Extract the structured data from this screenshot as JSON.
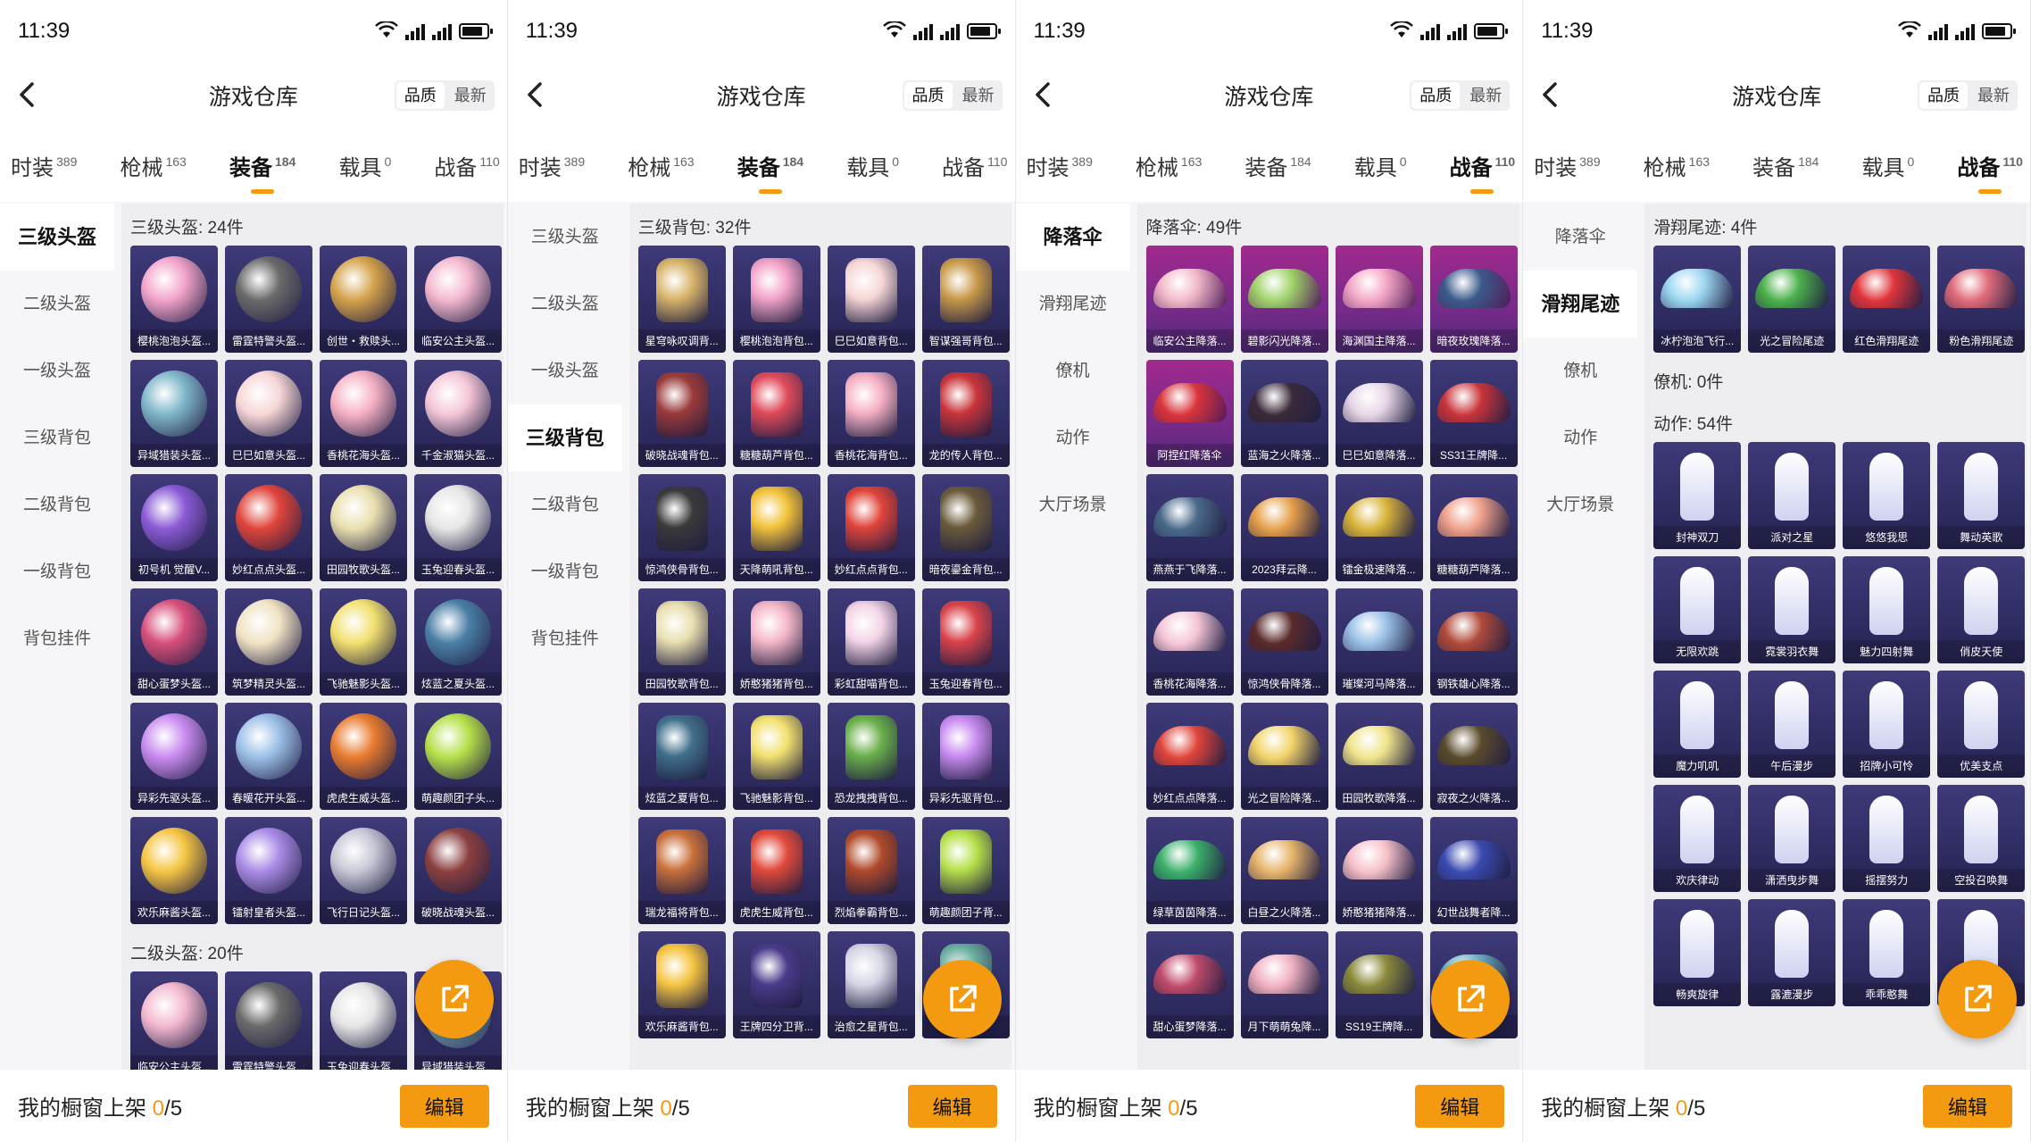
{
  "panels": [
    {
      "id": "p1",
      "time": "11:39",
      "title": "游戏仓库",
      "sort": [
        "品质",
        "最新"
      ],
      "tabs": [
        {
          "label": "时装",
          "count": "389",
          "active": false
        },
        {
          "label": "枪械",
          "count": "163",
          "active": false
        },
        {
          "label": "装备",
          "count": "184",
          "active": true
        },
        {
          "label": "载具",
          "count": "0",
          "active": false
        },
        {
          "label": "战备",
          "count": "110",
          "active": false
        }
      ],
      "side": [
        {
          "label": "三级头盔",
          "active": true
        },
        {
          "label": "二级头盔",
          "active": false
        },
        {
          "label": "一级头盔",
          "active": false
        },
        {
          "label": "三级背包",
          "active": false
        },
        {
          "label": "二级背包",
          "active": false
        },
        {
          "label": "一级背包",
          "active": false
        },
        {
          "label": "背包挂件",
          "active": false
        }
      ],
      "sections": [
        {
          "title": "三级头盔: 24件",
          "kind": "helmet",
          "items": [
            {
              "name": "樱桃泡泡头盔...",
              "color": "#f2a3c9"
            },
            {
              "name": "雷霆特警头盔...",
              "color": "#6a6a6a"
            },
            {
              "name": "创世・救赎头...",
              "color": "#d4a24a"
            },
            {
              "name": "临安公主头盔...",
              "color": "#f3b8cf"
            },
            {
              "name": "异域猎装头盔...",
              "color": "#7fb6c9"
            },
            {
              "name": "巳巳如意头盔...",
              "color": "#f7d6d6"
            },
            {
              "name": "香桃花海头盔...",
              "color": "#f6b1c4"
            },
            {
              "name": "千金淑猫头盔...",
              "color": "#f4c6d7"
            },
            {
              "name": "初号机 觉醒V...",
              "color": "#8b5bd6"
            },
            {
              "name": "妙红点点头盔...",
              "color": "#e0443a"
            },
            {
              "name": "田园牧歌头盔...",
              "color": "#e9dfae"
            },
            {
              "name": "玉兔迎春头盔...",
              "color": "#e6e6e6"
            },
            {
              "name": "甜心蛋梦头盔...",
              "color": "#d74f7b"
            },
            {
              "name": "筑梦精灵头盔...",
              "color": "#f1e3c3"
            },
            {
              "name": "飞驰魅影头盔...",
              "color": "#f2e06f"
            },
            {
              "name": "炫蓝之夏头盔...",
              "color": "#4a7fa6"
            },
            {
              "name": "异彩先驱头盔...",
              "color": "#c98bf0"
            },
            {
              "name": "春暖花开头盔...",
              "color": "#9bbfe6"
            },
            {
              "name": "虎虎生威头盔...",
              "color": "#e87a2e"
            },
            {
              "name": "萌趣颜团子头...",
              "color": "#b6e04a"
            },
            {
              "name": "欢乐麻酱头盔...",
              "color": "#f5c542"
            },
            {
              "name": "镭射皇者头盔...",
              "color": "#a98be6"
            },
            {
              "name": "飞行日记头盔...",
              "color": "#c7c7d6"
            },
            {
              "name": "破晓战魂头盔...",
              "color": "#8a3f3f"
            }
          ]
        },
        {
          "title": "二级头盔: 20件",
          "kind": "helmet",
          "items": [
            {
              "name": "临安公主头盔...",
              "color": "#f3b8cf"
            },
            {
              "name": "雷霆特警头盔...",
              "color": "#6a6a6a"
            },
            {
              "name": "玉兔迎春头盔...",
              "color": "#e6e6e6"
            },
            {
              "name": "异域猎装头盔...",
              "color": "#7fb6c9"
            }
          ]
        }
      ],
      "bottom": {
        "label": "我的橱窗上架",
        "count": "0",
        "total": "/5",
        "edit": "编辑"
      }
    },
    {
      "id": "p2",
      "time": "11:39",
      "title": "游戏仓库",
      "sort": [
        "品质",
        "最新"
      ],
      "tabs": [
        {
          "label": "时装",
          "count": "389",
          "active": false
        },
        {
          "label": "枪械",
          "count": "163",
          "active": false
        },
        {
          "label": "装备",
          "count": "184",
          "active": true
        },
        {
          "label": "载具",
          "count": "0",
          "active": false
        },
        {
          "label": "战备",
          "count": "110",
          "active": false
        }
      ],
      "side": [
        {
          "label": "三级头盔",
          "active": false
        },
        {
          "label": "二级头盔",
          "active": false
        },
        {
          "label": "一级头盔",
          "active": false
        },
        {
          "label": "三级背包",
          "active": true
        },
        {
          "label": "二级背包",
          "active": false
        },
        {
          "label": "一级背包",
          "active": false
        },
        {
          "label": "背包挂件",
          "active": false
        }
      ],
      "sections": [
        {
          "title": "三级背包: 32件",
          "kind": "pack",
          "items": [
            {
              "name": "星穹咏叹调背...",
              "color": "#d8b46a"
            },
            {
              "name": "樱桃泡泡背包...",
              "color": "#f2a3c9"
            },
            {
              "name": "巳巳如意背包...",
              "color": "#f7d6d6"
            },
            {
              "name": "智谋强哥背包...",
              "color": "#c99a4a"
            },
            {
              "name": "破晓战魂背包...",
              "color": "#9b3a3a"
            },
            {
              "name": "糖糖葫芦背包...",
              "color": "#e04a5a"
            },
            {
              "name": "香桃花海背包...",
              "color": "#f6b1c4"
            },
            {
              "name": "龙的传人背包...",
              "color": "#c9343a"
            },
            {
              "name": "惊鸿侠骨背包...",
              "color": "#3a3a3a"
            },
            {
              "name": "天降萌吼背包...",
              "color": "#f2c23a"
            },
            {
              "name": "妙红点点背包...",
              "color": "#e0443a"
            },
            {
              "name": "暗夜鎏金背包...",
              "color": "#6a5a3a"
            },
            {
              "name": "田园牧歌背包...",
              "color": "#e9dfae"
            },
            {
              "name": "娇憨猪猪背包...",
              "color": "#f6b8c8"
            },
            {
              "name": "彩虹甜喵背包...",
              "color": "#f3d4e6"
            },
            {
              "name": "玉兔迎春背包...",
              "color": "#d9434a"
            },
            {
              "name": "炫蓝之夏背包...",
              "color": "#3f6f8a"
            },
            {
              "name": "飞驰魅影背包...",
              "color": "#f2e06f"
            },
            {
              "name": "恐龙拽拽背包...",
              "color": "#6ab04a"
            },
            {
              "name": "异彩先驱背包...",
              "color": "#c98bf0"
            },
            {
              "name": "瑞龙福将背包...",
              "color": "#c9703a"
            },
            {
              "name": "虎虎生威背包...",
              "color": "#e04a3a"
            },
            {
              "name": "烈焰拳霸背包...",
              "color": "#b04a2a"
            },
            {
              "name": "萌趣颜团子背...",
              "color": "#b6e04a"
            },
            {
              "name": "欢乐麻酱背包...",
              "color": "#f5c542"
            },
            {
              "name": "王牌四分卫背...",
              "color": "#4a3a8a"
            },
            {
              "name": "治愈之星背包...",
              "color": "#d6d6e6"
            },
            {
              "name": "...",
              "color": "#6ab0a0"
            }
          ]
        }
      ],
      "bottom": {
        "label": "我的橱窗上架",
        "count": "0",
        "total": "/5",
        "edit": "编辑"
      }
    },
    {
      "id": "p3",
      "time": "11:39",
      "title": "游戏仓库",
      "sort": [
        "品质",
        "最新"
      ],
      "tabs": [
        {
          "label": "时装",
          "count": "389",
          "active": false
        },
        {
          "label": "枪械",
          "count": "163",
          "active": false
        },
        {
          "label": "装备",
          "count": "184",
          "active": false
        },
        {
          "label": "载具",
          "count": "0",
          "active": false
        },
        {
          "label": "战备",
          "count": "110",
          "active": true
        }
      ],
      "side": [
        {
          "label": "降落伞",
          "active": true
        },
        {
          "label": "滑翔尾迹",
          "active": false
        },
        {
          "label": "僚机",
          "active": false
        },
        {
          "label": "动作",
          "active": false
        },
        {
          "label": "大厅场景",
          "active": false
        }
      ],
      "sections": [
        {
          "title": "降落伞: 49件",
          "kind": "para",
          "items": [
            {
              "name": "临安公主降落...",
              "color": "#f2b8c8",
              "pink": true
            },
            {
              "name": "碧影闪光降落...",
              "color": "#9fd36a",
              "pink": true
            },
            {
              "name": "海渊国主降落...",
              "color": "#f3a6c6",
              "pink": true
            },
            {
              "name": "暗夜玫瑰降落...",
              "color": "#3a5a8a",
              "pink": true
            },
            {
              "name": "阿捏红降落伞",
              "color": "#d9343a",
              "pink": true
            },
            {
              "name": "蓝海之火降落...",
              "color": "#3a2a3a"
            },
            {
              "name": "巳巳如意降落...",
              "color": "#e6d6e6"
            },
            {
              "name": "SS31王牌降...",
              "color": "#c9343a"
            },
            {
              "name": "燕燕于飞降落...",
              "color": "#4a6a8a"
            },
            {
              "name": "2023拜云降...",
              "color": "#e6a04a"
            },
            {
              "name": "镭金极速降落...",
              "color": "#d9b43a"
            },
            {
              "name": "糖糖葫芦降落...",
              "color": "#f0a08a"
            },
            {
              "name": "香桃花海降落...",
              "color": "#f6c6d6"
            },
            {
              "name": "惊鸿侠骨降落...",
              "color": "#5a2a2a"
            },
            {
              "name": "璀璨河马降落...",
              "color": "#9ac0e6"
            },
            {
              "name": "钢铁雄心降落...",
              "color": "#b04a3a"
            },
            {
              "name": "妙红点点降落...",
              "color": "#e0443a"
            },
            {
              "name": "光之冒险降落...",
              "color": "#f2d46a"
            },
            {
              "name": "田园牧歌降落...",
              "color": "#f0e48a"
            },
            {
              "name": "寂夜之火降落...",
              "color": "#5a4a2a"
            },
            {
              "name": "绿草茵茵降落...",
              "color": "#3ab06a"
            },
            {
              "name": "白昼之火降落...",
              "color": "#e6b46a"
            },
            {
              "name": "娇憨猪猪降落...",
              "color": "#f6c0c8"
            },
            {
              "name": "幻世战舞者降...",
              "color": "#3a4ab0"
            },
            {
              "name": "甜心蛋梦降落...",
              "color": "#c04a6a"
            },
            {
              "name": "月下萌萌兔降...",
              "color": "#f0b0c0"
            },
            {
              "name": "SS19王牌降...",
              "color": "#8a8a3a"
            },
            {
              "name": "...",
              "color": "#6ab0c0"
            }
          ]
        }
      ],
      "bottom": {
        "label": "我的橱窗上架",
        "count": "0",
        "total": "/5",
        "edit": "编辑"
      }
    },
    {
      "id": "p4",
      "time": "11:39",
      "title": "游戏仓库",
      "sort": [
        "品质",
        "最新"
      ],
      "tabs": [
        {
          "label": "时装",
          "count": "389",
          "active": false
        },
        {
          "label": "枪械",
          "count": "163",
          "active": false
        },
        {
          "label": "装备",
          "count": "184",
          "active": false
        },
        {
          "label": "载具",
          "count": "0",
          "active": false
        },
        {
          "label": "战备",
          "count": "110",
          "active": true
        }
      ],
      "side": [
        {
          "label": "降落伞",
          "active": false
        },
        {
          "label": "滑翔尾迹",
          "active": true
        },
        {
          "label": "僚机",
          "active": false
        },
        {
          "label": "动作",
          "active": false
        },
        {
          "label": "大厅场景",
          "active": false
        }
      ],
      "sections": [
        {
          "title": "滑翔尾迹: 4件",
          "kind": "trail",
          "items": [
            {
              "name": "冰柠泡泡飞行...",
              "color": "#9ad6f0"
            },
            {
              "name": "光之冒险尾迹",
              "color": "#4ab04a"
            },
            {
              "name": "红色滑翔尾迹",
              "color": "#e0343a"
            },
            {
              "name": "粉色滑翔尾迹",
              "color": "#e06a7a"
            }
          ]
        },
        {
          "title": "僚机: 0件",
          "kind": "none",
          "items": []
        },
        {
          "title": "动作: 54件",
          "kind": "fig",
          "items": [
            {
              "name": "封神双刀",
              "color": "#ffffff"
            },
            {
              "name": "派对之星",
              "color": "#ffffff"
            },
            {
              "name": "悠悠我思",
              "color": "#ffffff"
            },
            {
              "name": "舞动英歌",
              "color": "#ffffff"
            },
            {
              "name": "无限欢跳",
              "color": "#ffffff"
            },
            {
              "name": "霓裳羽衣舞",
              "color": "#ffffff"
            },
            {
              "name": "魅力四射舞",
              "color": "#ffffff"
            },
            {
              "name": "俏皮天使",
              "color": "#ffffff"
            },
            {
              "name": "魔力叽叽",
              "color": "#ffffff"
            },
            {
              "name": "午后漫步",
              "color": "#ffffff"
            },
            {
              "name": "招牌小可怜",
              "color": "#ffffff"
            },
            {
              "name": "优美支点",
              "color": "#ffffff"
            },
            {
              "name": "欢庆律动",
              "color": "#ffffff"
            },
            {
              "name": "潇洒曳步舞",
              "color": "#ffffff"
            },
            {
              "name": "摇摆努力",
              "color": "#ffffff"
            },
            {
              "name": "空投召唤舞",
              "color": "#ffffff"
            },
            {
              "name": "畅爽旋律",
              "color": "#ffffff"
            },
            {
              "name": "露漉漫步",
              "color": "#ffffff"
            },
            {
              "name": "乖乖憨舞",
              "color": "#ffffff"
            },
            {
              "name": "...",
              "color": "#ffffff"
            }
          ]
        }
      ],
      "bottom": {
        "label": "我的橱窗上架",
        "count": "0",
        "total": "/5",
        "edit": "编辑"
      }
    }
  ],
  "accent": "#f39a11"
}
